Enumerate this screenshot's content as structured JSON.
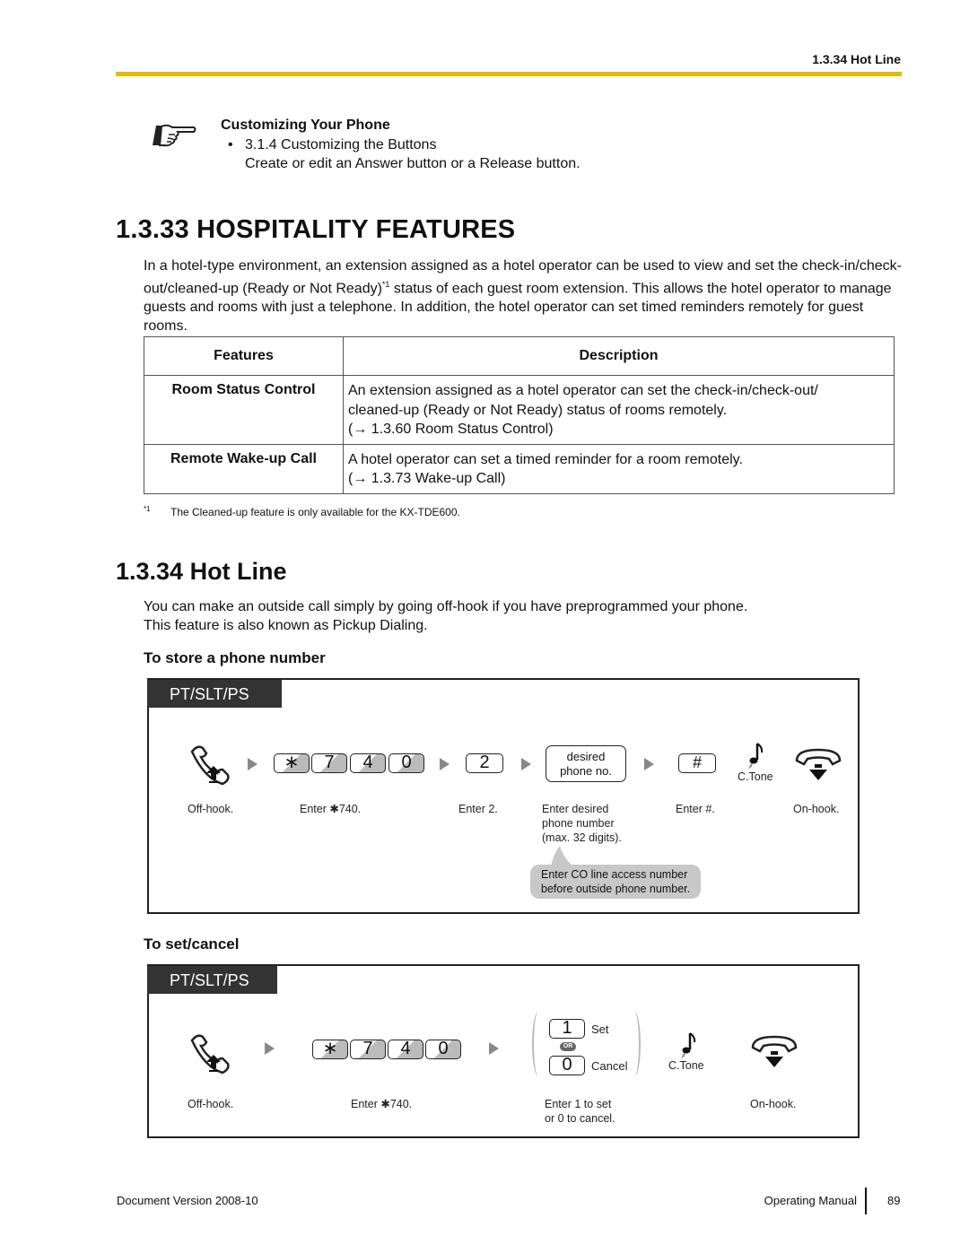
{
  "header": {
    "section_title": "1.3.34 Hot Line"
  },
  "reference": {
    "icon": "pointing-hand-icon",
    "title": "Customizing Your Phone",
    "bullet": "•",
    "item": "3.1.4  Customizing the Buttons",
    "item_desc": "Create or edit an Answer button or a Release button."
  },
  "hospitality": {
    "heading": "1.3.33  HOSPITALITY FEATURES",
    "intro_part1": "In a hotel-type environment, an extension assigned as a hotel operator can be used to view and set the check-in/check-out/cleaned-up (Ready or Not Ready)",
    "intro_footnote_ref": "*1",
    "intro_part2": " status of each guest room extension. This allows the hotel operator to manage guests and rooms with just a telephone. In addition, the hotel operator can set timed reminders remotely for guest rooms.",
    "table": {
      "headers": [
        "Features",
        "Description"
      ],
      "rows": [
        {
          "feature": "Room Status Control",
          "desc_lines": [
            "An extension assigned as a hotel operator can set the check-in/check-out/",
            "cleaned-up (Ready or Not Ready) status of rooms remotely.",
            "(→ 1.3.60  Room Status Control)"
          ]
        },
        {
          "feature": "Remote Wake-up Call",
          "desc_lines": [
            "A hotel operator can set a timed reminder for a room remotely.",
            "(→ 1.3.73  Wake-up Call)"
          ]
        }
      ]
    },
    "footnote_mark": "*1",
    "footnote_text": "The Cleaned-up feature is only available for the KX-TDE600."
  },
  "hotline": {
    "heading": "1.3.34  Hot Line",
    "intro_line1": "You can make an outside call simply by going off-hook if you have preprogrammed your phone.",
    "intro_line2": "This feature is also known as Pickup Dialing.",
    "store": {
      "subheading": "To store a phone number",
      "tag": "PT/SLT/PS",
      "keys_feature": [
        "∗",
        "7",
        "4",
        "0"
      ],
      "key_2": "2",
      "desired_line1": "desired",
      "desired_line2": "phone no.",
      "key_hash": "#",
      "tone_label": "C.Tone",
      "labels": {
        "offhook": "Off-hook.",
        "enter_code": "Enter ✱740.",
        "enter_2": "Enter 2.",
        "enter_desired_1": "Enter desired",
        "enter_desired_2": "phone number",
        "enter_desired_3": "(max. 32 digits).",
        "enter_hash": "Enter #.",
        "onhook": "On-hook."
      },
      "note_line1": "Enter CO line access number",
      "note_line2": "before outside phone number."
    },
    "setcancel": {
      "subheading": "To set/cancel",
      "tag": "PT/SLT/PS",
      "keys_feature": [
        "∗",
        "7",
        "4",
        "0"
      ],
      "key_set": "1",
      "set_label": "Set",
      "or_label": "OR",
      "key_cancel": "0",
      "cancel_label": "Cancel",
      "tone_label": "C.Tone",
      "labels": {
        "offhook": "Off-hook.",
        "enter_code": "Enter ✱740.",
        "enter_choice_1": "Enter 1 to set",
        "enter_choice_2": "or 0 to cancel.",
        "onhook": "On-hook."
      }
    }
  },
  "footer": {
    "version_label": "Document Version  2008-10",
    "manual_label": "Operating Manual",
    "page_number": "89"
  }
}
